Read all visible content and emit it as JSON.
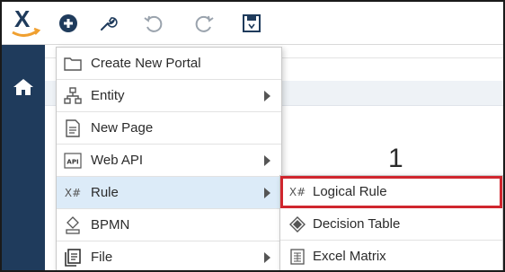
{
  "logo": {
    "letter": "X"
  },
  "toolbar": {
    "icons": [
      "add-circle-icon",
      "wrench-icon",
      "undo-icon",
      "redo-icon",
      "save-icon"
    ]
  },
  "sidebar": {
    "icons": [
      "home-icon"
    ]
  },
  "menu": {
    "items": [
      {
        "label": "Create New Portal",
        "icon": "folder-icon",
        "has_submenu": false
      },
      {
        "label": "Entity",
        "icon": "entity-hierarchy-icon",
        "has_submenu": true
      },
      {
        "label": "New Page",
        "icon": "page-icon",
        "has_submenu": false
      },
      {
        "label": "Web API",
        "icon": "api-icon",
        "icon_text": "API",
        "has_submenu": true
      },
      {
        "label": "Rule",
        "icon": "rule-icon",
        "icon_text": "X#",
        "has_submenu": true,
        "active": true
      },
      {
        "label": "BPMN",
        "icon": "bpmn-icon",
        "has_submenu": false
      },
      {
        "label": "File",
        "icon": "file-icon",
        "has_submenu": true
      }
    ]
  },
  "submenu": {
    "items": [
      {
        "label": "Logical Rule",
        "icon": "logical-rule-icon",
        "icon_text": "X#",
        "highlighted": true
      },
      {
        "label": "Decision Table",
        "icon": "decision-table-icon"
      },
      {
        "label": "Excel Matrix",
        "icon": "excel-matrix-icon"
      }
    ]
  },
  "callout": {
    "number": "1"
  },
  "colors": {
    "sidebar": "#1f3b5c",
    "logo_blue": "#1f3b5c",
    "logo_orange": "#f0a030",
    "add_button": "#1f3b5c",
    "active_item": "#dcebf8",
    "highlight_border": "#d0262e"
  }
}
